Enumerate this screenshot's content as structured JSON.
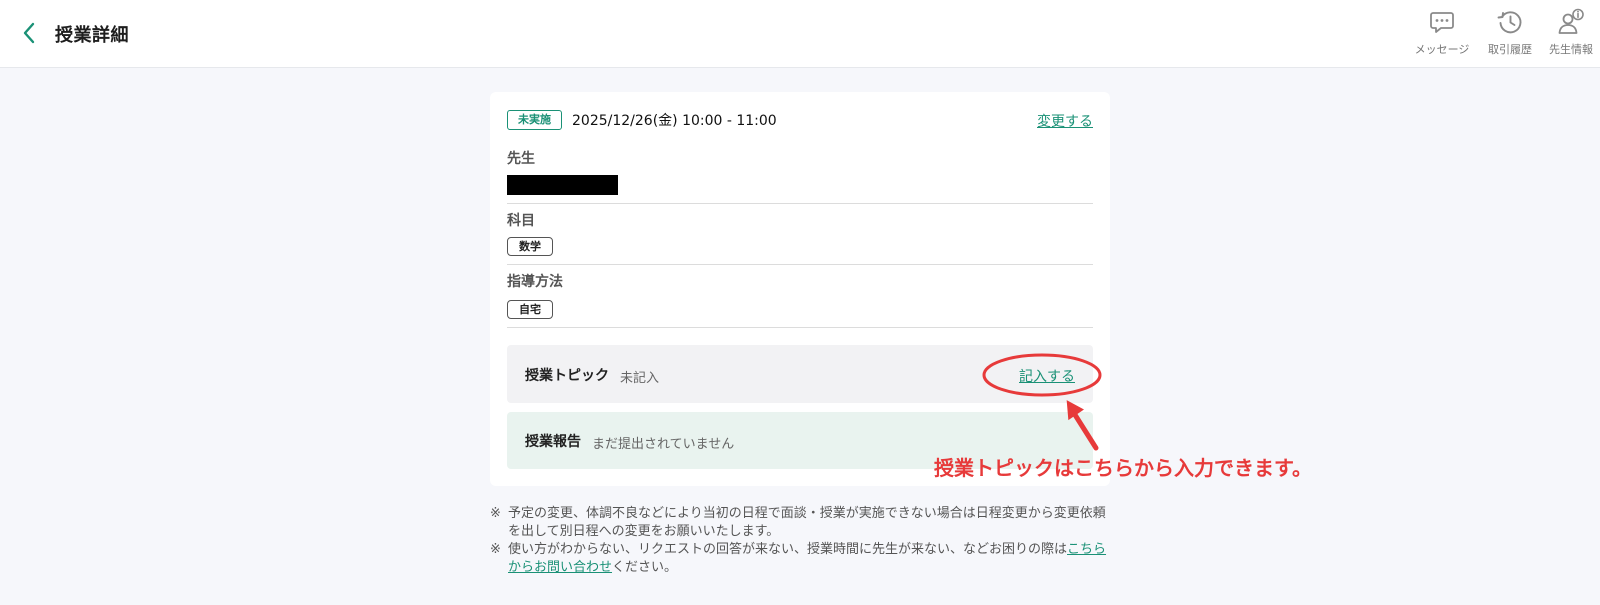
{
  "header": {
    "title": "授業詳細",
    "actions": [
      {
        "label": "メッセージ",
        "icon": "message-icon"
      },
      {
        "label": "取引履歴",
        "icon": "history-icon"
      },
      {
        "label": "先生情報",
        "icon": "teacher-info-icon"
      }
    ]
  },
  "lesson": {
    "status": "未実施",
    "datetime": "2025/12/26(金) 10:00 - 11:00",
    "change_label": "変更する",
    "teacher_label": "先生",
    "subject_label": "科目",
    "subject_value": "数学",
    "method_label": "指導方法",
    "method_value": "自宅",
    "topic": {
      "title": "授業トピック",
      "status": "未記入",
      "action": "記入する"
    },
    "report": {
      "title": "授業報告",
      "status": "まだ提出されていません"
    }
  },
  "notes": {
    "mark": "※",
    "note1": "予定の変更、体調不良などにより当初の日程で面談・授業が実施できない場合は日程変更から変更依頼を出して別日程への変更をお願いいたします。",
    "note2_pre": "使い方がわからない、リクエストの回答が来ない、授業時間に先生が来ない、などお困りの際は",
    "note2_link": "こちらからお問い合わせ",
    "note2_post": "ください。"
  },
  "annotation": {
    "text": "授業トピックはこちらから入力できます。"
  },
  "colors": {
    "accent": "#1a9176",
    "annotation": "#e73a3a",
    "report_bg": "#e9f3ef",
    "topic_bg": "#f2f2f4"
  }
}
